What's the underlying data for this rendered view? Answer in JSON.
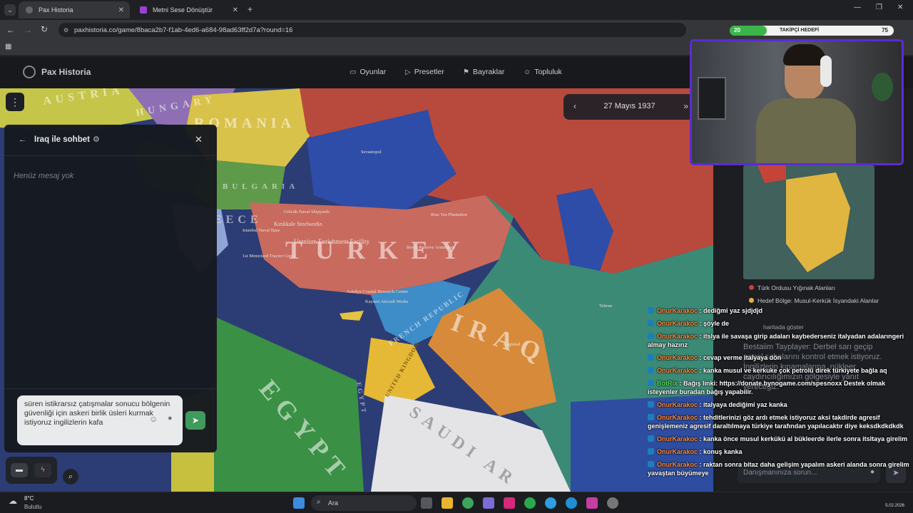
{
  "browser": {
    "tabs": [
      {
        "title": "Pax Historia",
        "active": true
      },
      {
        "title": "Metni Sese Dönüştür",
        "active": false
      }
    ],
    "url": "paxhistoria.co/game/8baca2b7-f1ab-4ed6-a684-98ad63ff2d7a?round=16"
  },
  "stream_overlay": {
    "goal_count": "20",
    "goal_label": "TAKİPÇİ HEDEFİ",
    "goal_target": "75"
  },
  "site": {
    "name": "Pax Historia",
    "nav": [
      {
        "label": "Oyunlar",
        "icon": "gamepad-icon"
      },
      {
        "label": "Presetler",
        "icon": "play-icon"
      },
      {
        "label": "Bayraklar",
        "icon": "flag-icon"
      },
      {
        "label": "Topluluk",
        "icon": "people-icon"
      }
    ]
  },
  "date_bar": {
    "date": "27 Mayıs 1937"
  },
  "map": {
    "regions": [
      "AUSTRIA",
      "HUNGARY",
      "ROMANIA",
      "BULGARIA",
      "EECE",
      "TURKEY",
      "FRENCH REPUBLIC",
      "IRAQ",
      "EGYPT",
      "UNITED KINGDOM",
      "SAUDI AR",
      "EGYPT"
    ],
    "cities": [
      "Sevastopol",
      "Gölcük Naval Shipyards",
      "Kırıkkale Steelworks",
      "Istanbul Naval Base",
      "Uranium Enrichment Facility",
      "1st Motorized Tractor Corps",
      "Rize Tea Plantation",
      "Borda Reserve Armament",
      "Antalya Coastal Research Center",
      "Tehran",
      "Baghdad",
      "Kayseri Aircraft Works"
    ]
  },
  "chat": {
    "title": "Iraq ile sohbet",
    "empty_text": "Henüz mesaj yok",
    "draft": "süren istikrarsız çatışmalar sonucu bölgenin güvenliği için askeri birlik üsleri kurmak istiyoruz ingilizlerin kafa"
  },
  "side_card": {
    "legend": [
      {
        "label": "Türk Ordusu Yığınak Alanları",
        "color": "#d23b3b"
      },
      {
        "label": "Hedef Bölge: Musul-Kerkük İsyandaki Alanlar",
        "color": "#e3b437"
      }
    ],
    "show_on_map": "haritada göster",
    "intro": "Bestaiim Tayplayer: Derbel sarı geçip petrol sahalarını kontrol etmek istiyoruz. İngilizlerin kınamalarına, nükleer caydırıcılığımızın gölgesiyle yanıt vereceğiz.",
    "advisor_placeholder": "Danışmanınıza sorun..."
  },
  "twitch_chat": [
    {
      "user": "OnurKarakoc",
      "text": "dediğmi yaz sjdjdjd"
    },
    {
      "user": "OnurKarakoc",
      "text": "şöyle de"
    },
    {
      "user": "OnurKarakoc",
      "text": "itslya ile savaşa girip adaları kaybederseniz italyadan adalarıngeri almay hazırız"
    },
    {
      "user": "OnurKarakoc",
      "text": "cevap verme italyaya dön"
    },
    {
      "user": "OnurKarakoc",
      "text": "kanka musul ve kerkuke çok petrolü direk türkiyete bağla aq"
    },
    {
      "user": "BotRix",
      "text": "Bağış linki: https://donate.bynogame.com/spesnoxx Destek olmak isteyenler buradan bağış yapabilir.",
      "bot": true
    },
    {
      "user": "OnurKarakoc",
      "text": "italyaya dediğimi yaz kanka"
    },
    {
      "user": "OnurKarakoc",
      "text": "tehditlerinizi göz ardı etmek istiyoruz aksi takdirde agresif genişlemeniz agresif daraltılmaya türkiye tarafından yapılacaktır diye keksdkdkdkdk"
    },
    {
      "user": "OnurKarakoc",
      "text": "kanka önce musul kerkükü al bükleerde ilerle sonra itsltaya girelim"
    },
    {
      "user": "OnurKarakoc",
      "text": "konuş kanka"
    },
    {
      "user": "OnurKarakoc",
      "text": "raktan sonra bitaz daha gelişim yapalım askeri alanda sonra girelim yavaştan büyümeye"
    }
  ],
  "taskbar": {
    "weather_temp": "8°C",
    "weather_desc": "Bulutlu",
    "search_placeholder": "Ara",
    "date": "5.02.2026"
  }
}
